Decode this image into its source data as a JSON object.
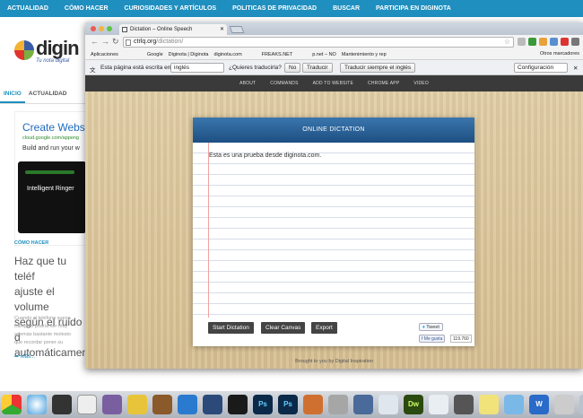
{
  "bg_site": {
    "nav": [
      "ACTUALIDAD",
      "CÓMO HACER",
      "CURIOSIDADES Y ARTÍCULOS",
      "POLITICAS DE PRIVACIDAD",
      "BUSCAR",
      "PARTICIPA EN DIGINOTA"
    ],
    "logo_text": "digin",
    "logo_sub": "Tu nota digital",
    "tabs": [
      "INICIO",
      "ACTUALIDAD"
    ],
    "ad_title": "Create Webs",
    "ad_url": "cloud.google.com/appeng",
    "ad_body": "Build and run your w",
    "phone_label": "Intelligent Ringer",
    "category": "CÓMO HACER",
    "article_lines": [
      "Haz que tu teléf",
      "ajuste el volume",
      "según el ruido d",
      "automáticamen"
    ],
    "small_lines": [
      "Cuando el teléfono suena",
      "tranquilo podría ser muy",
      "además bastante molesto",
      "que recordar poner su"
    ],
    "more": "Más..."
  },
  "browser": {
    "tab_title": "Dictation – Online Speech",
    "url_domain": "ctrlq.org",
    "url_path": "/dictation/",
    "bookmarks": [
      "Aplicaciones",
      "Google",
      "Diginota | Diginota",
      "diginota.com",
      "FREAKS.NET",
      "p.net – NO",
      "Mantenimiento y rep"
    ],
    "other_bookmarks": "Otros marcadores",
    "translate": {
      "prompt": "Esta página está escrita en",
      "language": "inglés",
      "question": "¿Quieres traducirla?",
      "no": "No",
      "translate": "Traducir",
      "always": "Traducir siempre el inglés",
      "config": "Configuración"
    }
  },
  "site": {
    "nav": [
      "ABOUT",
      "COMMANDS",
      "ADD TO WEBSITE",
      "CHROME APP",
      "VIDEO"
    ],
    "panel_title": "ONLINE DICTATION",
    "text": "Esta es una prueba desde diginota.com.",
    "buttons": {
      "start": "Start Dictation",
      "clear": "Clear Canvas",
      "export": "Export"
    },
    "tweet": "Tweet",
    "fb_like": "Me gusta",
    "fb_count": "119.760",
    "footer": "Brought to you by Digital Inspiration"
  },
  "colors": {
    "accent": "#1f8fbf",
    "panel_header": "#2a5f94"
  }
}
